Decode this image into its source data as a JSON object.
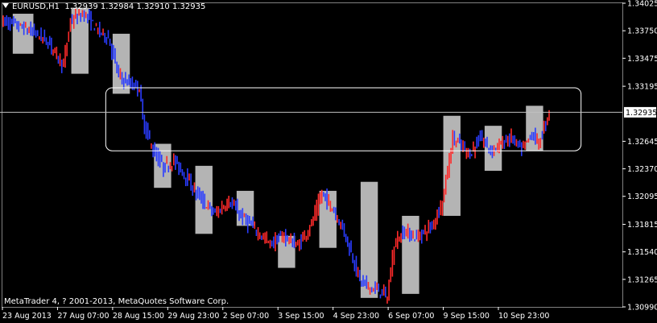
{
  "header": {
    "symbol_timeframe": "EURUSD,H1",
    "ohlc": "1.32939 1.32984 1.32910 1.32935"
  },
  "copyright": "MetaTrader 4, ? 2001-2013, MetaQuotes Software Corp.",
  "colors": {
    "background": "#000000",
    "bull": "#ff2a2a",
    "bear": "#2a3cff",
    "box": "#b4b4b4",
    "frame": "#ffffff",
    "price_line": "#c0c0c0"
  },
  "chart_data": {
    "type": "candlestick",
    "symbol": "EURUSD",
    "timeframe": "H1",
    "current_price": "1.32935",
    "ylim": [
      1.3099,
      1.34025
    ],
    "y_ticks": [
      "1.34025",
      "1.33750",
      "1.33475",
      "1.33195",
      "1.32935",
      "1.32645",
      "1.32370",
      "1.32095",
      "1.31815",
      "1.31540",
      "1.31265",
      "1.30990"
    ],
    "x_ticks": [
      "23 Aug 2013",
      "27 Aug 07:00",
      "28 Aug 15:00",
      "29 Aug 23:00",
      "2 Sep 07:00",
      "3 Sep 15:00",
      "4 Sep 23:00",
      "6 Sep 07:00",
      "9 Sep 15:00",
      "10 Sep 23:00"
    ],
    "x_range_bars": [
      0,
      180
    ],
    "x_tick_bars": [
      0,
      16,
      32,
      48,
      64,
      80,
      96,
      112,
      128,
      144
    ],
    "path_anchors": [
      [
        0,
        1.3385
      ],
      [
        6,
        1.3378
      ],
      [
        10,
        1.3372
      ],
      [
        14,
        1.3362
      ],
      [
        18,
        1.334
      ],
      [
        20,
        1.3385
      ],
      [
        24,
        1.3392
      ],
      [
        28,
        1.3375
      ],
      [
        31,
        1.3368
      ],
      [
        34,
        1.333
      ],
      [
        37,
        1.3322
      ],
      [
        40,
        1.3318
      ],
      [
        41,
        1.3285
      ],
      [
        44,
        1.3255
      ],
      [
        47,
        1.3238
      ],
      [
        50,
        1.3245
      ],
      [
        53,
        1.3232
      ],
      [
        56,
        1.3215
      ],
      [
        59,
        1.3202
      ],
      [
        62,
        1.3192
      ],
      [
        66,
        1.3205
      ],
      [
        70,
        1.3188
      ],
      [
        74,
        1.3175
      ],
      [
        78,
        1.3162
      ],
      [
        82,
        1.317
      ],
      [
        86,
        1.316
      ],
      [
        90,
        1.3182
      ],
      [
        93,
        1.3212
      ],
      [
        96,
        1.3198
      ],
      [
        99,
        1.3178
      ],
      [
        102,
        1.3148
      ],
      [
        104,
        1.3125
      ],
      [
        107,
        1.3118
      ],
      [
        110,
        1.3115
      ],
      [
        112,
        1.3108
      ],
      [
        114,
        1.3162
      ],
      [
        117,
        1.3175
      ],
      [
        120,
        1.3168
      ],
      [
        122,
        1.3172
      ],
      [
        125,
        1.318
      ],
      [
        128,
        1.3205
      ],
      [
        131,
        1.3268
      ],
      [
        134,
        1.3258
      ],
      [
        136,
        1.3252
      ],
      [
        139,
        1.3268
      ],
      [
        142,
        1.3255
      ],
      [
        145,
        1.3262
      ],
      [
        148,
        1.3268
      ],
      [
        151,
        1.3255
      ],
      [
        154,
        1.3272
      ],
      [
        156,
        1.3262
      ],
      [
        159,
        1.3294
      ]
    ],
    "session_boxes": [
      {
        "b0": 3,
        "b1": 9,
        "low": 1.3352,
        "high": 1.3392
      },
      {
        "b0": 20,
        "b1": 25,
        "low": 1.3332,
        "high": 1.3398
      },
      {
        "b0": 32,
        "b1": 37,
        "low": 1.3312,
        "high": 1.3372
      },
      {
        "b0": 44,
        "b1": 49,
        "low": 1.3218,
        "high": 1.3262
      },
      {
        "b0": 56,
        "b1": 61,
        "low": 1.3172,
        "high": 1.324
      },
      {
        "b0": 68,
        "b1": 73,
        "low": 1.318,
        "high": 1.3215
      },
      {
        "b0": 80,
        "b1": 85,
        "low": 1.3138,
        "high": 1.317
      },
      {
        "b0": 92,
        "b1": 97,
        "low": 1.3158,
        "high": 1.3215
      },
      {
        "b0": 104,
        "b1": 109,
        "low": 1.3108,
        "high": 1.3224
      },
      {
        "b0": 116,
        "b1": 121,
        "low": 1.3112,
        "high": 1.319
      },
      {
        "b0": 128,
        "b1": 133,
        "low": 1.319,
        "high": 1.329
      },
      {
        "b0": 140,
        "b1": 145,
        "low": 1.3235,
        "high": 1.328
      },
      {
        "b0": 152,
        "b1": 157,
        "low": 1.3255,
        "high": 1.33
      }
    ],
    "range_frame": {
      "b0": 30,
      "b1": 168,
      "low": 1.3255,
      "high": 1.3318
    }
  }
}
